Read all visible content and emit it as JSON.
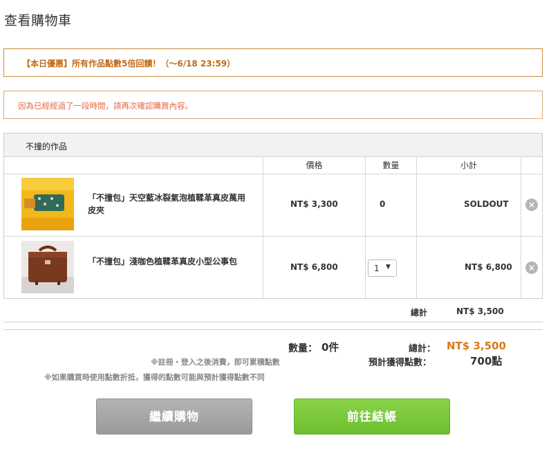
{
  "page_title": "查看購物車",
  "promo_notice": "【本日優惠】所有作品點數5倍回饋！（～6/18 23:59）",
  "warning_notice": "因為已經經過了一段時間，請再次確認購買內容。",
  "cart": {
    "shop_name": "不撞的作品",
    "columns": {
      "price": "價格",
      "quantity": "數量",
      "subtotal": "小計"
    },
    "items": [
      {
        "name": "「不撞包」天空藍冰裂氣泡植鞣革真皮萬用皮夾",
        "price": "NT$ 3,300",
        "quantity": "0",
        "subtotal": "SOLDOUT",
        "remove": "×"
      },
      {
        "name": "「不撞包」淺咖色植鞣革真皮小型公事包",
        "price": "NT$ 6,800",
        "quantity": "1",
        "subtotal": "NT$ 6,800",
        "remove": "×"
      }
    ],
    "subtotal_label": "總計",
    "subtotal_value": "NT$ 3,500"
  },
  "summary": {
    "qty_label": "數量：",
    "qty_value": "0件",
    "total_label": "總計：",
    "total_value": "NT$ 3,500",
    "points_label": "預計獲得點數：",
    "points_value": "700點",
    "note_register": "※註冊・登入之後消費，即可累積點數",
    "note_points": "※如果購買時使用點數折抵，獲得的點數可能與預計獲得點數不同"
  },
  "buttons": {
    "continue": "繼續購物",
    "checkout": "前往結帳"
  },
  "colors": {
    "accent_orange": "#d77a1c",
    "checkout_green": "#6cbf2e",
    "notice_border": "#c8893b",
    "warning_text": "#e06a45"
  }
}
